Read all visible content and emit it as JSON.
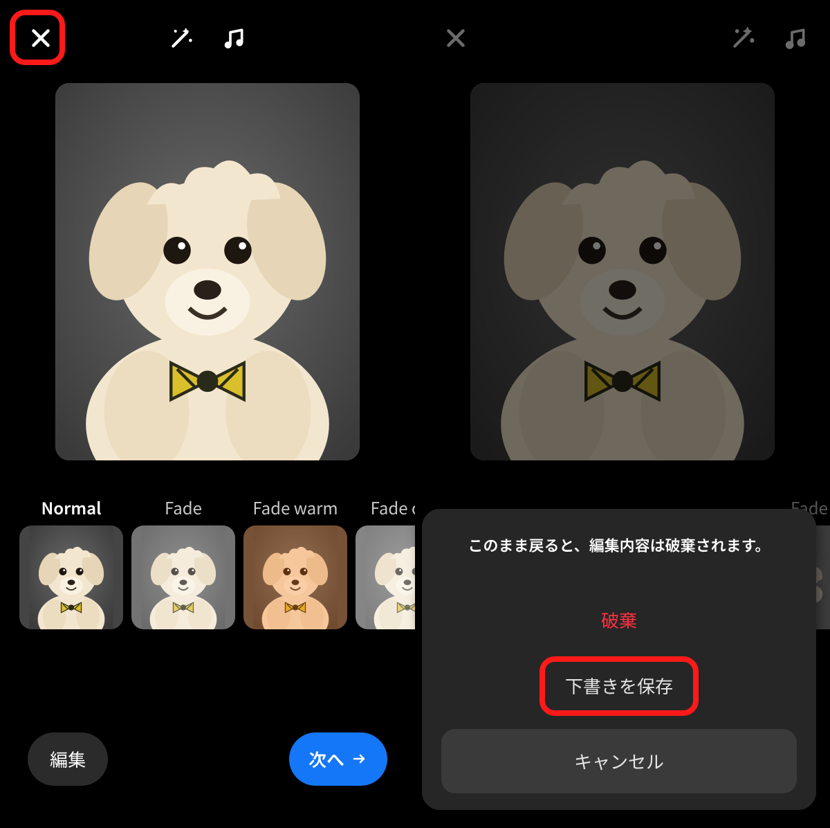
{
  "left": {
    "filters": [
      {
        "label": "Normal",
        "selected": true,
        "tint": ""
      },
      {
        "label": "Fade",
        "selected": false,
        "tint": "tint-fade"
      },
      {
        "label": "Fade warm",
        "selected": false,
        "tint": "tint-warm"
      },
      {
        "label": "Fade cool",
        "selected": false,
        "tint": "tint-cool"
      }
    ],
    "edit_label": "編集",
    "next_label": "次へ"
  },
  "right": {
    "filters_peek_label": "Fade",
    "dialog": {
      "message": "このまま戻ると、編集内容は破棄されます。",
      "discard": "破棄",
      "save_draft": "下書きを保存",
      "cancel": "キャンセル"
    }
  }
}
